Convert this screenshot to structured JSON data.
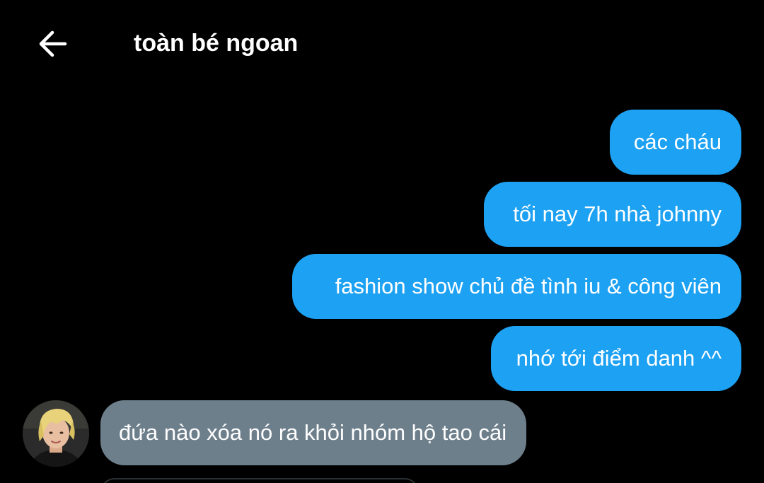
{
  "header": {
    "title": "toàn bé ngoan",
    "back_icon": "arrow-left-icon"
  },
  "colors": {
    "background": "#000000",
    "outgoing_bubble": "#1da1f2",
    "incoming_bubble": "#6e7f8c",
    "text": "#ffffff"
  },
  "messages": [
    {
      "direction": "outgoing",
      "text": "các cháu"
    },
    {
      "direction": "outgoing",
      "text": "tối nay 7h nhà johnny"
    },
    {
      "direction": "outgoing",
      "text": "fashion show chủ đề tình iu & công viên"
    },
    {
      "direction": "outgoing",
      "text": "nhớ tới điểm danh ^^"
    },
    {
      "direction": "incoming",
      "text": "đứa nào xóa nó ra khỏi nhóm hộ tao cái"
    }
  ]
}
